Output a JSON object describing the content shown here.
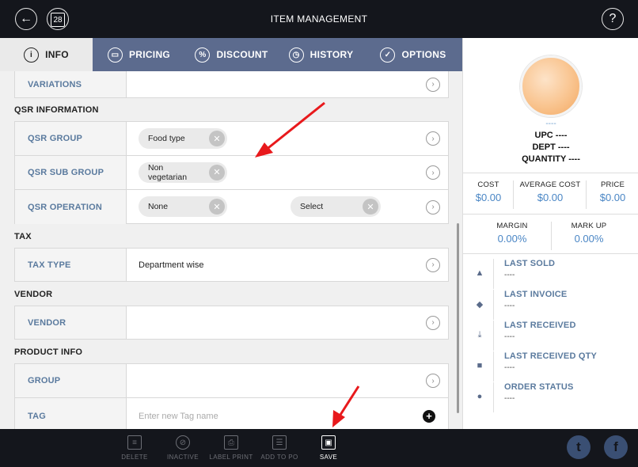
{
  "topbar": {
    "title": "ITEM MANAGEMENT",
    "back_icon": "←",
    "calendar_day": "28",
    "help_icon": "?"
  },
  "tabs": [
    {
      "label": "INFO",
      "icon": "i"
    },
    {
      "label": "PRICING",
      "icon": "▭"
    },
    {
      "label": "DISCOUNT",
      "icon": "%"
    },
    {
      "label": "HISTORY",
      "icon": "◷"
    },
    {
      "label": "OPTIONS",
      "icon": "✓"
    }
  ],
  "sections": {
    "variations": {
      "label": "VARIATIONS"
    },
    "qsr": {
      "title": "QSR INFORMATION",
      "group_label": "QSR GROUP",
      "group_chip": "Food type",
      "sub_group_label": "QSR SUB GROUP",
      "sub_group_chip_line1": "Non",
      "sub_group_chip_line2": "vegetarian",
      "operation_label": "QSR OPERATION",
      "operation_chip1": "None",
      "operation_chip2": "Select"
    },
    "tax": {
      "title": "TAX",
      "type_label": "TAX TYPE",
      "type_value": "Department wise"
    },
    "vendor": {
      "title": "VENDOR",
      "vendor_label": "VENDOR"
    },
    "product": {
      "title": "PRODUCT INFO",
      "group_label": "GROUP",
      "tag_label": "TAG",
      "tag_placeholder": "Enter new Tag name"
    }
  },
  "right_panel": {
    "image_caption": "----",
    "upc": "UPC ----",
    "dept": "DEPT ----",
    "quantity": "QUANTITY ----",
    "cost_label": "COST",
    "cost_value": "$0.00",
    "avg_cost_label": "AVERAGE COST",
    "avg_cost_value": "$0.00",
    "price_label": "PRICE",
    "price_value": "$0.00",
    "margin_label": "MARGIN",
    "margin_value": "0.00%",
    "markup_label": "MARK UP",
    "markup_value": "0.00%",
    "history": [
      {
        "title": "LAST SOLD",
        "value": "----"
      },
      {
        "title": "LAST INVOICE",
        "value": "----"
      },
      {
        "title": "LAST RECEIVED",
        "value": "----"
      },
      {
        "title": "LAST RECEIVED QTY",
        "value": "----"
      },
      {
        "title": "ORDER STATUS",
        "value": "----"
      }
    ]
  },
  "bottombar": {
    "delete": "DELETE",
    "inactive": "INACTIVE",
    "label_print": "LABEL PRINT",
    "add_to_po": "ADD TO PO",
    "save": "SAVE",
    "twitter_glyph": "t",
    "facebook_glyph": "f"
  },
  "colors": {
    "topbar": "#14161c",
    "tabs_bg": "#5c6b8e",
    "label_blue": "#5a7a9e",
    "value_blue": "#4a86c5",
    "arrow_red": "#e8191c"
  }
}
